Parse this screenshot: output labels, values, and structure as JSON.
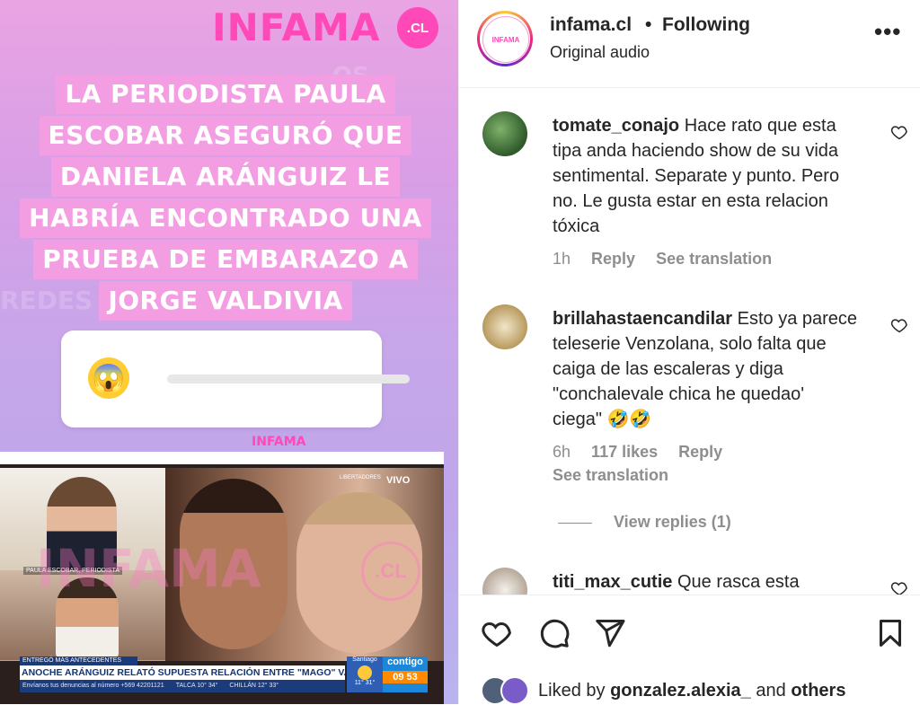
{
  "media": {
    "brand": "INFAMA",
    "brand_dot": ".CL",
    "headline_lines": [
      "LA PERIODISTA PAULA",
      "ESCOBAR ASEGURÓ QUE",
      "DANIELA ARÁNGUIZ LE",
      "HABRÍA ENCONTRADO UNA",
      "PRUEBA DE EMBARAZO A",
      "JORGE VALDIVIA"
    ],
    "poll_emoji": "😱",
    "watermark_small": "INFAMA",
    "tv": {
      "name_tag": "PAULA ESCOBAR, PERIODISTA",
      "live": "VIVO",
      "cup": "LIBERTADORES",
      "watermark": "INFAMA",
      "watermark_dot": ".CL",
      "ticker_top": "ENTREGÓ MÁS ANTECEDENTES",
      "ticker_main": "ANOCHE ARÁNGUIZ RELATÓ SUPUESTA RELACIÓN ENTRE \"MAGO\" VALDIVIA Y DIP. ORSINI",
      "ticker_bottom": [
        "Envíanos tus denuncias al número +569 42201121",
        "TALCA 10° 34°",
        "CHILLÁN 12° 33°"
      ],
      "weather_city": "Santiago",
      "weather_temp": "11° 31°",
      "channel": "contigo",
      "clock": "09 53"
    }
  },
  "post": {
    "username": "infama.cl",
    "follow_state": "Following",
    "audio": "Original audio",
    "avatar_text": "INFAMA"
  },
  "comments": [
    {
      "user": "tomate_conajo",
      "text": "Hace rato que esta tipa anda haciendo show de su vida sentimental. Separate y punto. Pero no. Le gusta estar en esta relacion tóxica",
      "time": "1h",
      "reply": "Reply",
      "translate": "See translation"
    },
    {
      "user": "brillahastaencandilar",
      "text": "Esto ya parece teleserie Venzolana, solo falta que caiga de las escaleras y diga \"conchalevale chica he quedao' ciega\" 🤣🤣",
      "time": "6h",
      "likes": "117 likes",
      "reply": "Reply",
      "translate": "See translation",
      "view_replies": "View replies (1)"
    },
    {
      "user": "titi_max_cutie",
      "text": "Que rasca esta"
    }
  ],
  "footer": {
    "liked_prefix": "Liked by",
    "liked_user": "gonzalez.alexia_",
    "liked_suffix": "and",
    "liked_others": "others"
  }
}
